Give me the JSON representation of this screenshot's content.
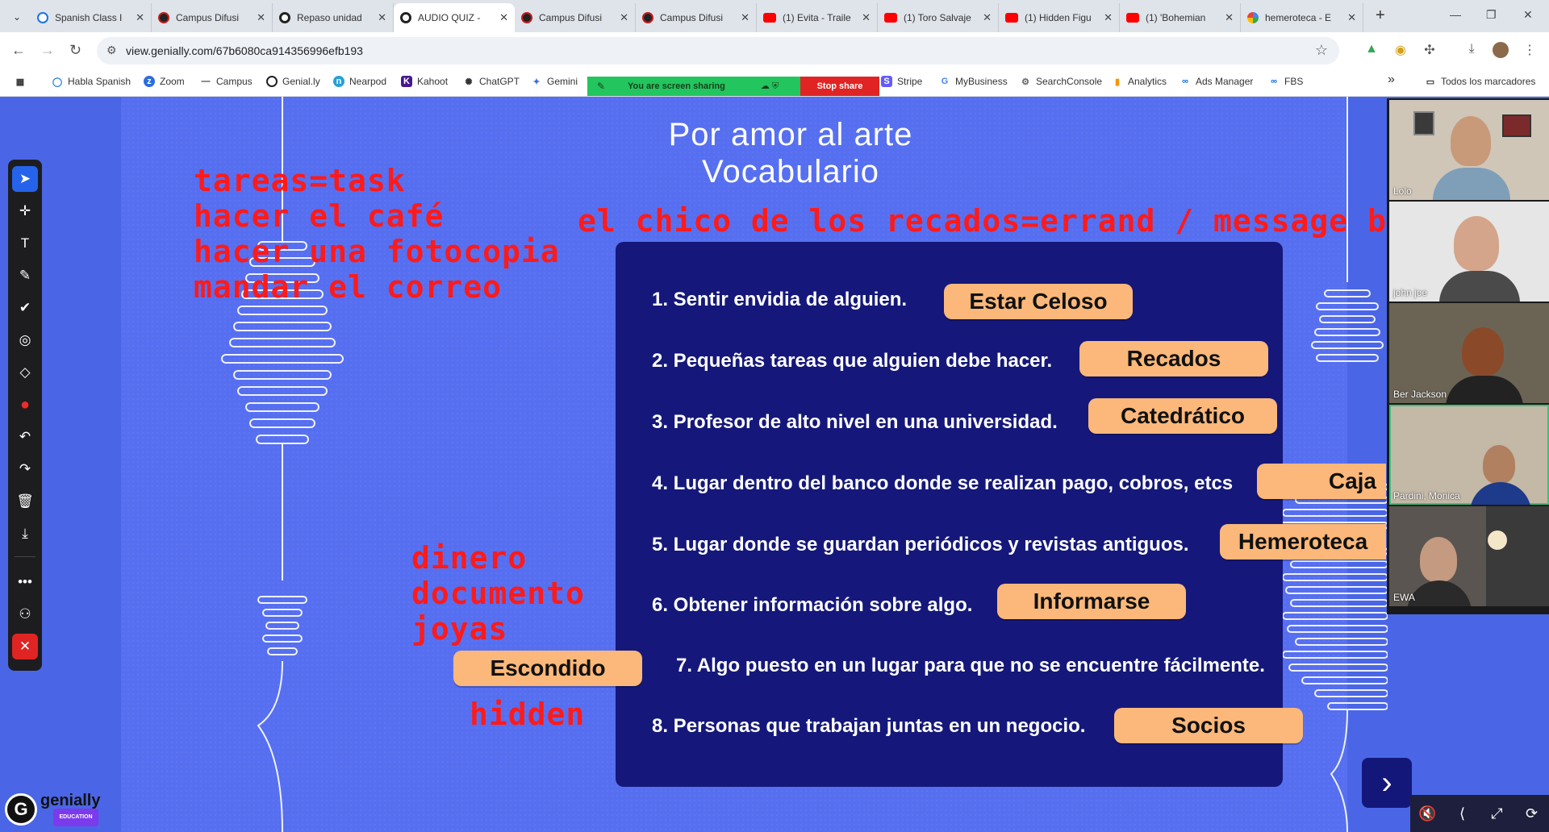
{
  "browser": {
    "tabs": [
      {
        "label": "Spanish Class I",
        "icon": "search-favicon-icon",
        "active": false
      },
      {
        "label": "Campus Difusi",
        "icon": "campus-favicon-icon",
        "active": false
      },
      {
        "label": "Campus Difusi",
        "icon": "campus-favicon-icon",
        "active": false
      },
      {
        "label": "Repaso unidad",
        "icon": "genially-favicon-icon",
        "active": false
      },
      {
        "label": "AUDIO QUIZ -",
        "icon": "genially-favicon-icon",
        "active": true
      },
      {
        "label": "Campus Difusi",
        "icon": "campus-favicon-icon",
        "active": false
      },
      {
        "label": "Campus Difusi",
        "icon": "campus-favicon-icon",
        "active": false
      },
      {
        "label": "(1) Evita - Traile",
        "icon": "youtube-favicon-icon",
        "active": false
      },
      {
        "label": "(1) Toro Salvaje",
        "icon": "youtube-favicon-icon",
        "active": false
      },
      {
        "label": "(1) Hidden Figu",
        "icon": "youtube-favicon-icon",
        "active": false
      },
      {
        "label": "(1) 'Bohemian",
        "icon": "youtube-favicon-icon",
        "active": false
      },
      {
        "label": "hemeroteca - E",
        "icon": "google-favicon-icon",
        "active": false
      }
    ],
    "url": "view.genially.com/67b6080ca914356996efb193",
    "bookmarks": [
      {
        "label": "Habla Spanish",
        "icon": "search-icon"
      },
      {
        "label": "Zoom",
        "icon": "zoom-icon"
      },
      {
        "label": "Campus",
        "icon": "dash-icon"
      },
      {
        "label": "Genial.ly",
        "icon": "genially-icon"
      },
      {
        "label": "Nearpod",
        "icon": "nearpod-icon"
      },
      {
        "label": "Kahoot",
        "icon": "kahoot-icon"
      },
      {
        "label": "ChatGPT",
        "icon": "chatgpt-icon"
      },
      {
        "label": "Gemini",
        "icon": "gemini-icon"
      },
      {
        "label": "Stripe",
        "icon": "stripe-icon"
      },
      {
        "label": "MyBusiness",
        "icon": "google-icon"
      },
      {
        "label": "SearchConsole",
        "icon": "searchconsole-icon"
      },
      {
        "label": "Analytics",
        "icon": "analytics-icon"
      },
      {
        "label": "Ads Manager",
        "icon": "meta-icon"
      },
      {
        "label": "FBS",
        "icon": "meta-icon"
      }
    ],
    "bookmarks_overflow": "»",
    "all_bookmarks": "Todos los marcadores",
    "screen_share": {
      "text": "You are screen sharing",
      "stop_label": "Stop share"
    }
  },
  "slide": {
    "title_line1": "Por amor al arte",
    "title_line2": "Vocabulario",
    "questions": [
      {
        "text": "1. Sentir envidia de  alguien.",
        "answer": "Estar Celoso"
      },
      {
        "text": "2. Pequeñas tareas que alguien debe hacer.",
        "answer": "Recados"
      },
      {
        "text": "3. Profesor de alto nivel en una universidad.",
        "answer": "Catedrático"
      },
      {
        "text": "4. Lugar dentro del banco donde se realizan pago, cobros, etcs",
        "answer": "Caja"
      },
      {
        "text": "5. Lugar donde se guardan periódicos y revistas antiguos.",
        "answer": "Hemeroteca"
      },
      {
        "text": "6. Obtener información sobre algo.",
        "answer": "Informarse"
      },
      {
        "text": "7. Algo puesto en un lugar para que no se encuentre fácilmente.",
        "answer": "Escondido"
      },
      {
        "text": "8. Personas que trabajan juntas en un negocio.",
        "answer": "Socios"
      }
    ],
    "next_label": "›"
  },
  "annotations": {
    "tasks": [
      "tareas=task",
      "hacer el café",
      "hacer una fotocopia",
      "mandar el correo"
    ],
    "errand": "el chico de los recados=errand / message boy",
    "valuables": [
      "dinero",
      "documento",
      "joyas"
    ],
    "hidden": "hidden"
  },
  "participants": [
    {
      "name": "Lolo"
    },
    {
      "name": "john joe"
    },
    {
      "name": "Ber Jackson"
    },
    {
      "name": "Pardini, Monica",
      "speaking": true
    },
    {
      "name": "EWA"
    }
  ],
  "logo": {
    "name": "genially",
    "sub": "EDUCATION"
  },
  "colors": {
    "slide_bg": "#566ff0",
    "panel_bg": "#15187a",
    "answer_bg": "#fbb87a",
    "annotation": "#ff1a1a",
    "share_green": "#22c55e",
    "stop_red": "#e02424"
  }
}
